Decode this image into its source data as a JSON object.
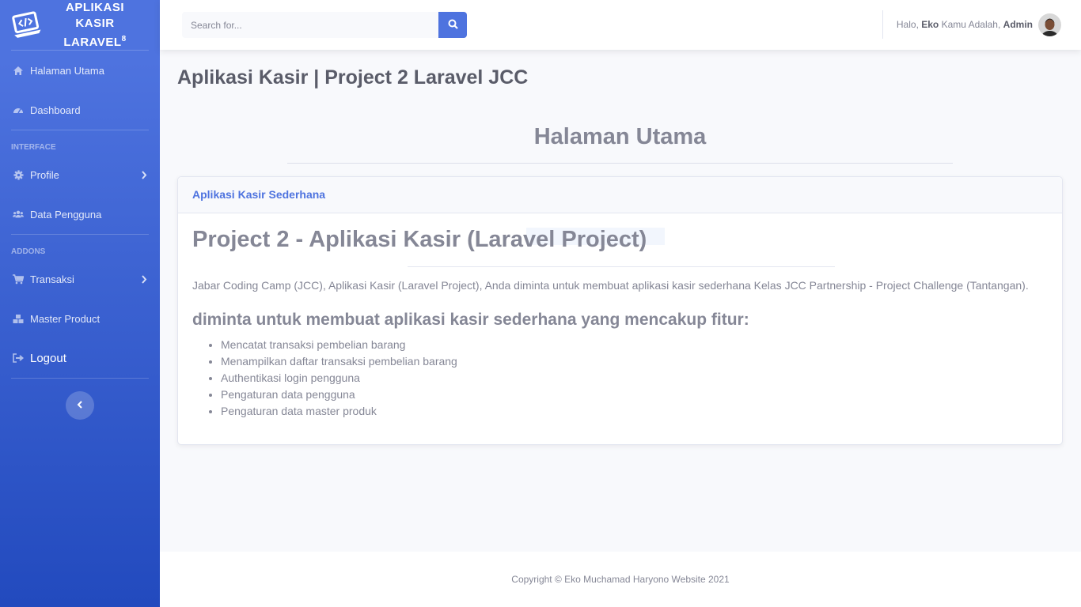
{
  "brand": {
    "line1": "APLIKASI",
    "line2": "KASIR",
    "line3": "LARAVEL",
    "superscript": "8",
    "icon": "code-laptop-icon"
  },
  "sidebar": {
    "items": [
      {
        "label": "Halaman Utama",
        "icon": "home-icon"
      },
      {
        "label": "Dashboard",
        "icon": "tachometer-icon"
      }
    ],
    "heading_interface": "INTERFACE",
    "interface_items": [
      {
        "label": "Profile",
        "icon": "cog-icon",
        "has_submenu": true
      },
      {
        "label": "Data Pengguna",
        "icon": "users-icon"
      }
    ],
    "heading_addons": "ADDONS",
    "addons_items": [
      {
        "label": "Transaksi",
        "icon": "shopping-cart-icon",
        "has_submenu": true
      },
      {
        "label": "Master Product",
        "icon": "cubes-icon"
      },
      {
        "label": "Logout",
        "icon": "sign-out-icon"
      }
    ],
    "toggle_icon": "chevron-left-icon"
  },
  "topbar": {
    "search_placeholder": "Search for...",
    "search_icon": "search-icon",
    "greeting": "Halo, ",
    "user_name": "Eko",
    "role_prefix": " Kamu Adalah, ",
    "role": "Admin"
  },
  "main": {
    "page_title": "Aplikasi Kasir | Project 2 Laravel JCC",
    "section_title": "Halaman Utama",
    "card": {
      "header": "Aplikasi Kasir Sederhana",
      "title": "Project 2 - Aplikasi Kasir (Laravel Project)",
      "paragraph": "Jabar Coding Camp (JCC), Aplikasi Kasir (Laravel Project), Anda diminta untuk membuat aplikasi kasir sederhana Kelas JCC Partnership - Project Challenge (Tantangan).",
      "subtitle": "diminta untuk membuat aplikasi kasir sederhana yang mencakup fitur:",
      "features": [
        "Mencatat transaksi pembelian barang",
        "Menampilkan daftar transaksi pembelian barang",
        "Authentikasi login pengguna",
        "Pengaturan data pengguna",
        "Pengaturan data master produk"
      ]
    }
  },
  "footer": {
    "text": "Copyright © Eko Muchamad Haryono Website 2021"
  },
  "colors": {
    "primary": "#4e73df",
    "primary_dark": "#224abe",
    "text": "#858796",
    "background": "#f8f9fc"
  }
}
